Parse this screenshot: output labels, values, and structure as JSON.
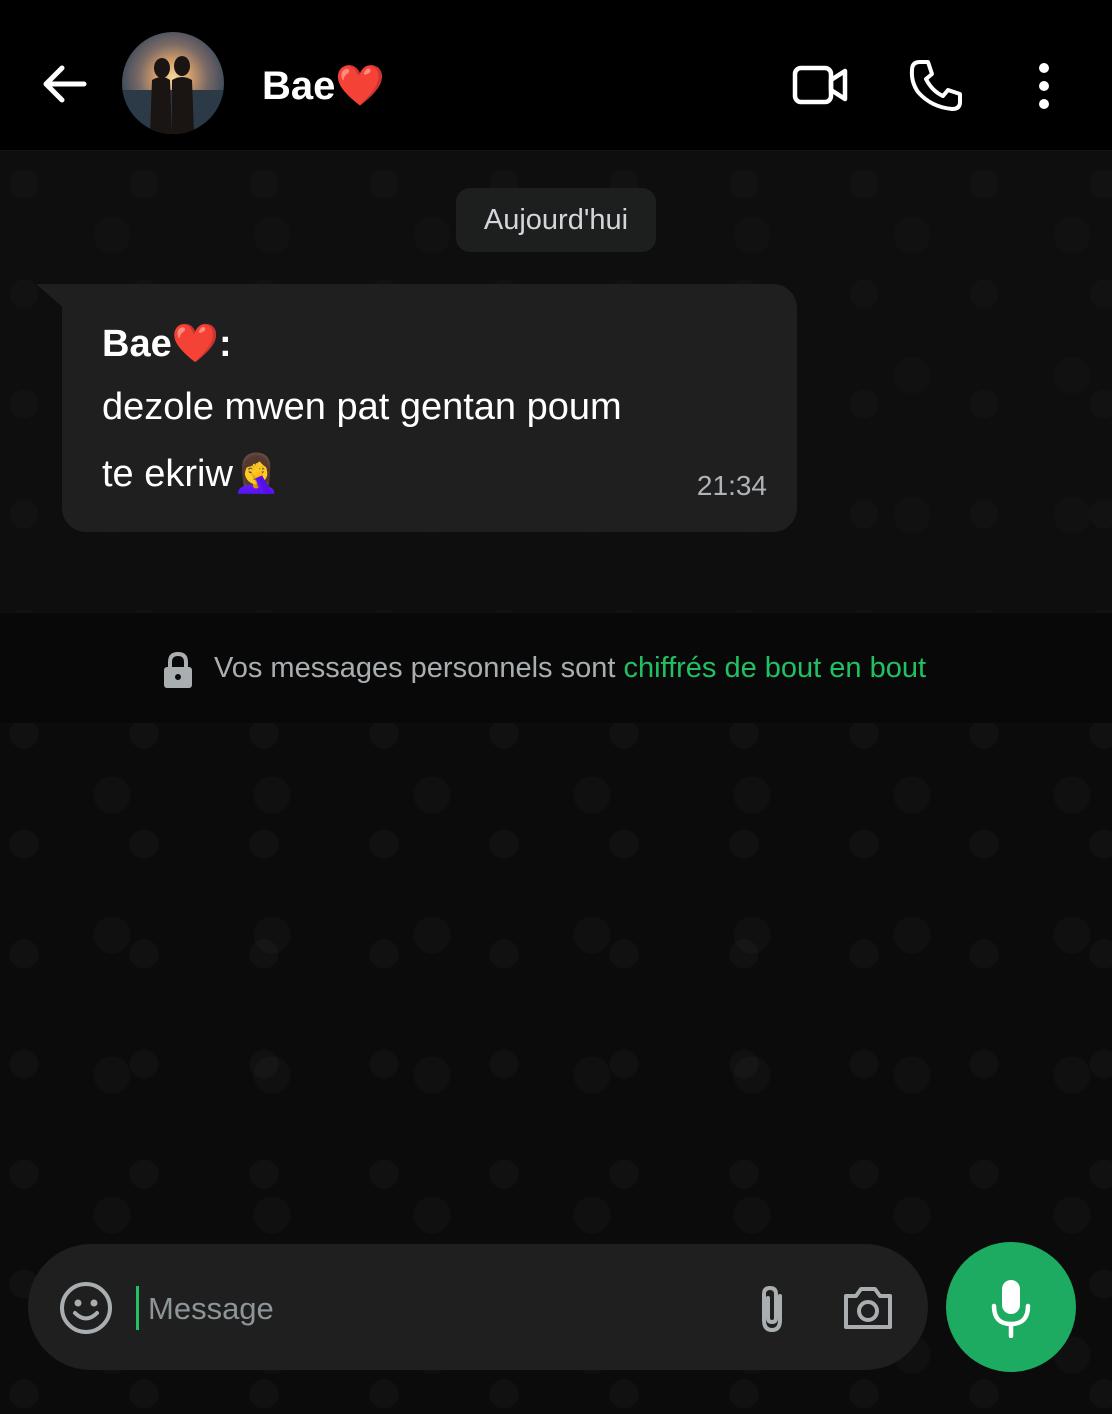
{
  "header": {
    "contact_name": "Bae❤️",
    "back_icon": "arrow-left-icon",
    "video_icon": "video-camera-icon",
    "call_icon": "phone-icon",
    "menu_icon": "more-vertical-icon"
  },
  "chat": {
    "date_label": "Aujourd'hui",
    "message": {
      "sender": "Bae❤️:",
      "line1": "dezole mwen pat gentan poum",
      "line2": "te ekriw🤦‍♀️",
      "time": "21:34"
    },
    "encryption": {
      "text": "Vos messages personnels sont ",
      "link": "chiffrés de bout en bout"
    }
  },
  "composer": {
    "placeholder": "Message",
    "value": ""
  },
  "colors": {
    "accent": "#1daa61",
    "link": "#21c063",
    "bubble": "#1f1f1f"
  }
}
